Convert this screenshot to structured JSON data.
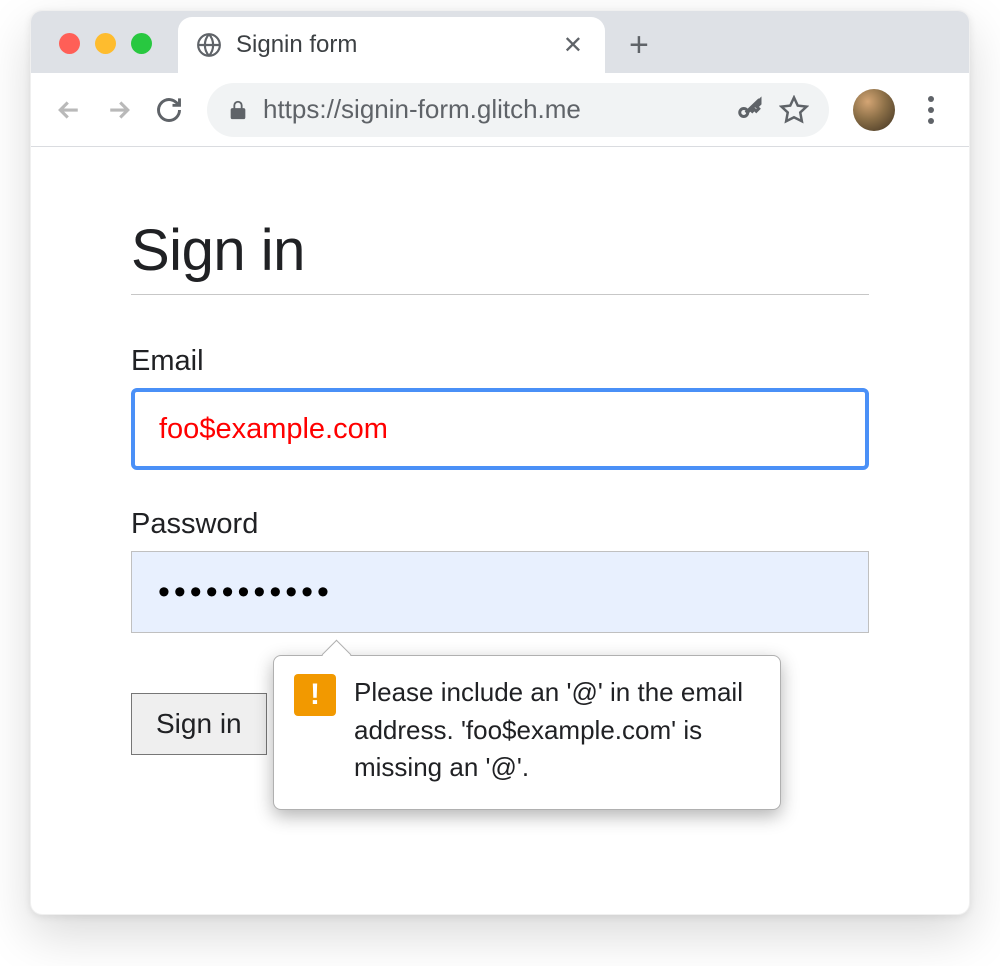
{
  "browser": {
    "tab_title": "Signin form",
    "url": "https://signin-form.glitch.me"
  },
  "page": {
    "heading": "Sign in",
    "email_label": "Email",
    "email_value": "foo$example.com",
    "password_label": "Password",
    "password_value": "•••••••••••",
    "submit_label": "Sign in"
  },
  "validation": {
    "message": "Please include an '@' in the email address. 'foo$example.com' is missing an '@'."
  }
}
